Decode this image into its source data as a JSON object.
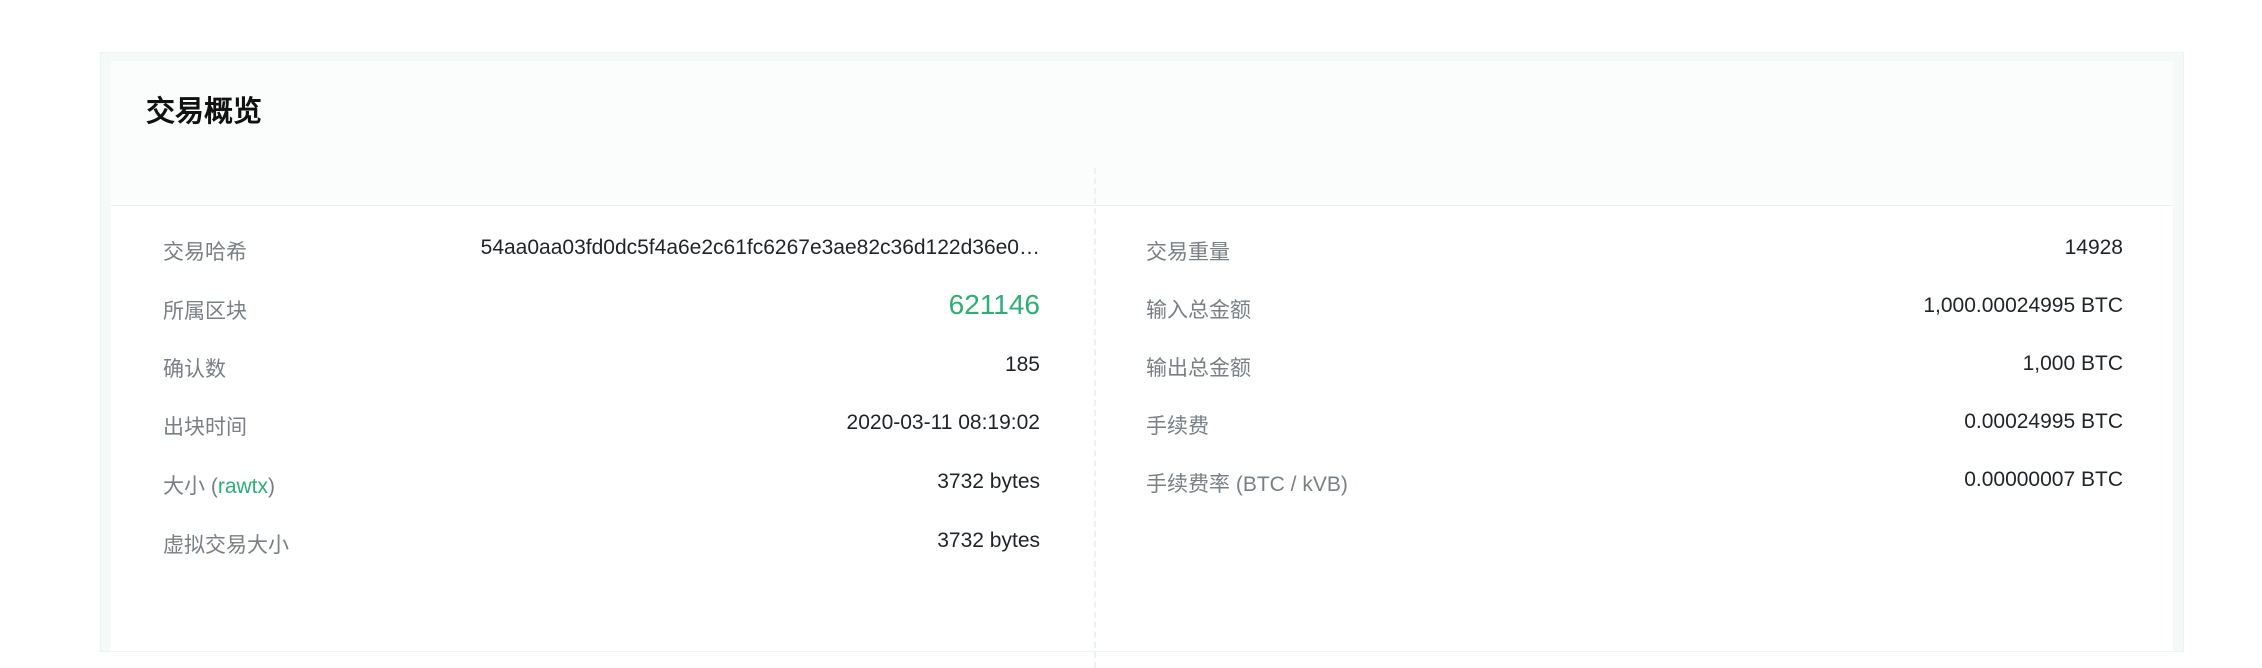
{
  "overview": {
    "title": "交易概览",
    "left": {
      "tx_hash": {
        "label": "交易哈希",
        "value": "54aa0aa03fd0dc5f4a6e2c61fc6267e3ae82c36d122d36e0…"
      },
      "block": {
        "label": "所属区块",
        "value": "621146"
      },
      "confirmations": {
        "label": "确认数",
        "value": "185"
      },
      "block_time": {
        "label": "出块时间",
        "value": "2020-03-11 08:19:02"
      },
      "size": {
        "label_prefix": "大小 (",
        "label_link": "rawtx",
        "label_suffix": ")",
        "value": "3732 bytes"
      },
      "vsize": {
        "label": "虚拟交易大小",
        "value": "3732 bytes"
      }
    },
    "right": {
      "weight": {
        "label": "交易重量",
        "value": "14928"
      },
      "total_input": {
        "label": "输入总金额",
        "value": "1,000.00024995 BTC"
      },
      "total_output": {
        "label": "输出总金额",
        "value": "1,000 BTC"
      },
      "fee": {
        "label": "手续费",
        "value": "0.00024995 BTC"
      },
      "fee_rate": {
        "label": "手续费率 (BTC / kVB)",
        "value": "0.00000007 BTC"
      }
    }
  },
  "colors": {
    "accent_green": "#2fae74",
    "label_gray": "#7a7f85",
    "value_dark": "#1f2329"
  }
}
